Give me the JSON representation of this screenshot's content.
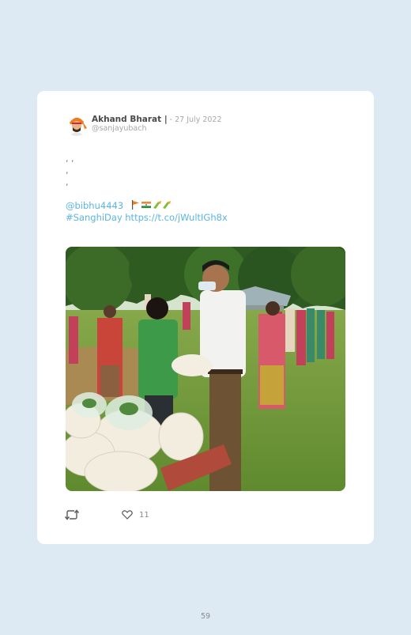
{
  "tweet": {
    "display_name": "Akhand Bharat |",
    "date": " - 27 July 2022",
    "handle": "@sanjayubach",
    "text_lines": [
      ", ,",
      ",",
      ","
    ],
    "mention": "@bibhu4443",
    "hashtag": "#SanghiDay",
    "url": "https://t.co/jWultIGh8x"
  },
  "actions": {
    "retweet_icon": "retweet-icon",
    "like_icon": "heart-icon",
    "like_count": "11"
  },
  "footer": {
    "page_number": "59"
  },
  "colors": {
    "page_background": "#dde9f3",
    "card_background": "#ffffff",
    "link": "#5ab4e6",
    "muted_text": "#a7a7a7"
  }
}
